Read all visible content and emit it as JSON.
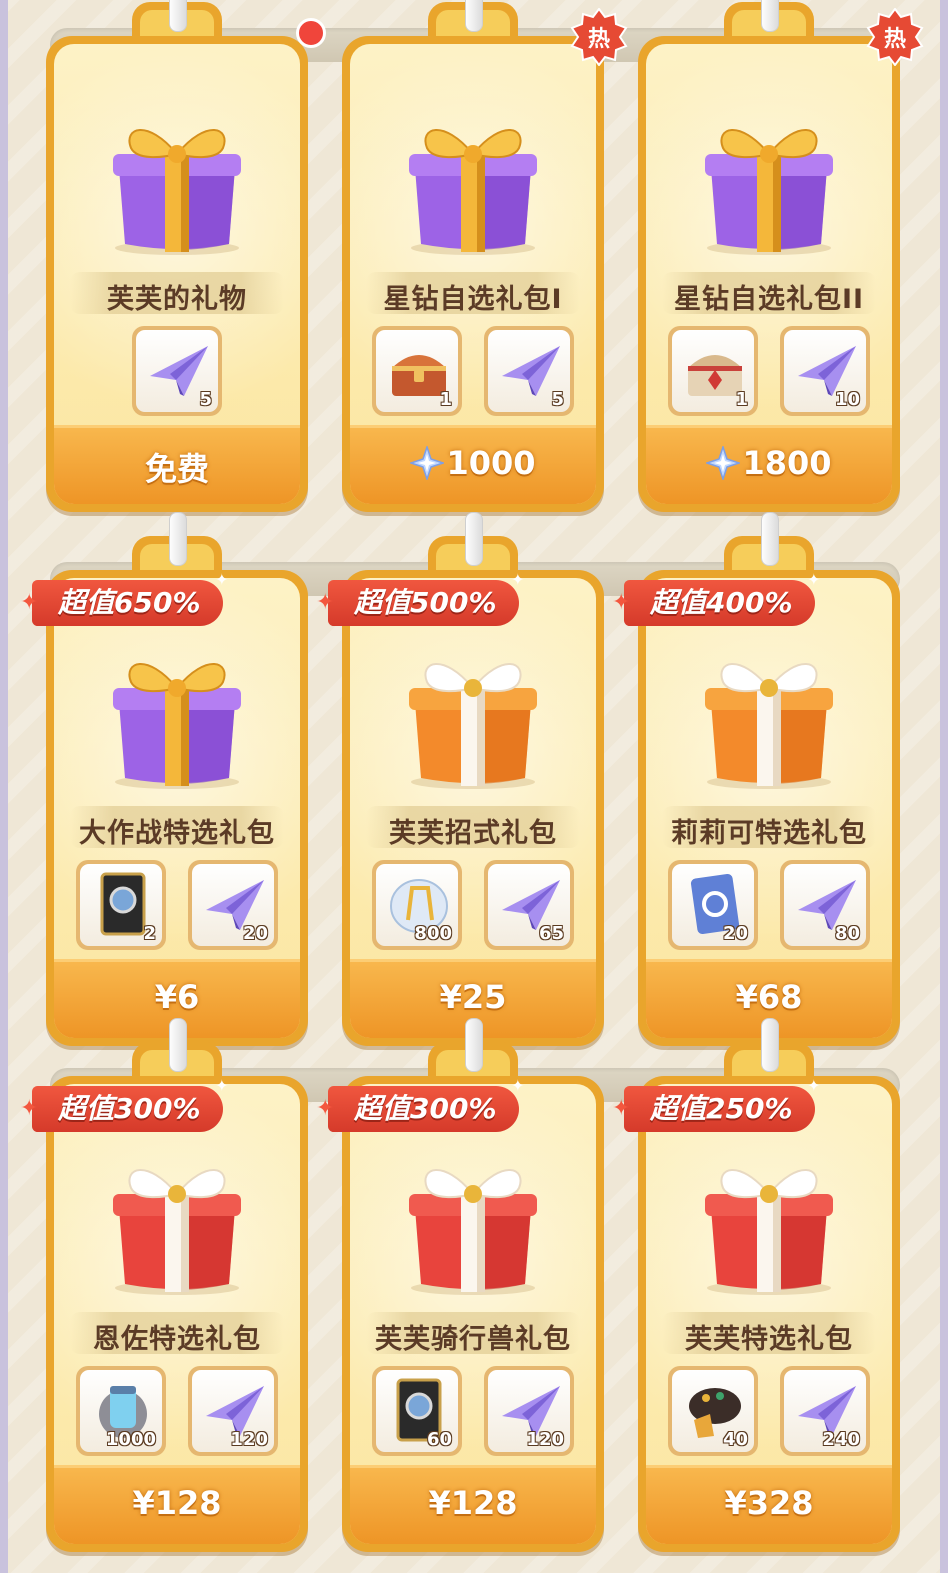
{
  "currency_symbol_icon": "star-diamond-icon",
  "rows": [
    {
      "cards": [
        {
          "title": "芙芙的礼物",
          "price": "免费",
          "price_icon": "",
          "badge": "dot",
          "ribbon": "",
          "gift": "purple",
          "items": [
            {
              "icon": "paper-plane-icon",
              "qty": "5"
            }
          ]
        },
        {
          "title": "星钻自选礼包I",
          "price": "1000",
          "price_icon": "star-diamond-icon",
          "badge": "热",
          "ribbon": "",
          "gift": "purple",
          "items": [
            {
              "icon": "treasure-chest-icon",
              "qty": "1"
            },
            {
              "icon": "paper-plane-icon",
              "qty": "5"
            }
          ]
        },
        {
          "title": "星钻自选礼包II",
          "price": "1800",
          "price_icon": "star-diamond-icon",
          "badge": "热",
          "ribbon": "",
          "gift": "purple",
          "items": [
            {
              "icon": "treasure-chest-gold-icon",
              "qty": "1"
            },
            {
              "icon": "paper-plane-icon",
              "qty": "10"
            }
          ]
        }
      ]
    },
    {
      "cards": [
        {
          "title": "大作战特选礼包",
          "price": "¥6",
          "badge": "",
          "ribbon": "超值650%",
          "gift": "purple",
          "items": [
            {
              "icon": "ticket-card-icon",
              "qty": "2"
            },
            {
              "icon": "paper-plane-icon",
              "qty": "20"
            }
          ]
        },
        {
          "title": "芙芙招式礼包",
          "price": "¥25",
          "badge": "",
          "ribbon": "超值500%",
          "gift": "orange",
          "items": [
            {
              "icon": "crystal-orb-icon",
              "qty": "800"
            },
            {
              "icon": "paper-plane-icon",
              "qty": "65"
            }
          ]
        },
        {
          "title": "莉莉可特选礼包",
          "price": "¥68",
          "badge": "",
          "ribbon": "超值400%",
          "gift": "orange",
          "items": [
            {
              "icon": "blue-card-icon",
              "qty": "20"
            },
            {
              "icon": "paper-plane-icon",
              "qty": "80"
            }
          ]
        }
      ]
    },
    {
      "cards": [
        {
          "title": "恩佐特选礼包",
          "price": "¥128",
          "badge": "",
          "ribbon": "超值300%",
          "gift": "red",
          "items": [
            {
              "icon": "gear-capsule-icon",
              "qty": "1000"
            },
            {
              "icon": "paper-plane-icon",
              "qty": "120"
            }
          ]
        },
        {
          "title": "芙芙骑行兽礼包",
          "price": "¥128",
          "badge": "",
          "ribbon": "超值300%",
          "gift": "red",
          "items": [
            {
              "icon": "ticket-card-icon",
              "qty": "60"
            },
            {
              "icon": "paper-plane-icon",
              "qty": "120"
            }
          ]
        },
        {
          "title": "芙芙特选礼包",
          "price": "¥328",
          "badge": "",
          "ribbon": "超值250%",
          "gift": "red",
          "items": [
            {
              "icon": "food-bowl-icon",
              "qty": "40"
            },
            {
              "icon": "paper-plane-icon",
              "qty": "240"
            }
          ]
        }
      ]
    }
  ],
  "colors": {
    "card_border": "#e9a52c",
    "price_bar": "#ee9526",
    "ribbon": "#d53a2a",
    "hot_badge": "#e64a34",
    "title_text": "#5b3b26"
  }
}
